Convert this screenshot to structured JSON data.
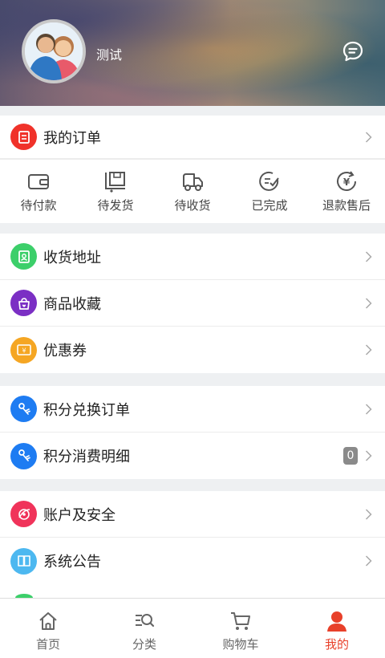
{
  "profile": {
    "username": "测试"
  },
  "orders": {
    "title": "我的订单",
    "statuses": [
      "待付款",
      "待发货",
      "待收货",
      "已完成",
      "退款售后"
    ]
  },
  "menu1": [
    {
      "label": "收货地址",
      "color": "#3ccf6a"
    },
    {
      "label": "商品收藏",
      "color": "#7b2fc4"
    },
    {
      "label": "优惠券",
      "color": "#f5a623"
    }
  ],
  "menu2": [
    {
      "label": "积分兑换订单",
      "color": "#1e7cf2"
    },
    {
      "label": "积分消费明细",
      "color": "#1e7cf2",
      "badge": "0"
    }
  ],
  "menu3": [
    {
      "label": "账户及安全",
      "color": "#f0335a"
    },
    {
      "label": "系统公告",
      "color": "#4db8f0"
    }
  ],
  "tabbar": [
    {
      "label": "首页",
      "icon": "home-icon"
    },
    {
      "label": "分类",
      "icon": "category-search-icon"
    },
    {
      "label": "购物车",
      "icon": "cart-icon"
    },
    {
      "label": "我的",
      "icon": "user-icon",
      "active": true
    }
  ],
  "colors": {
    "accent": "#e8402a",
    "orders_icon": "#f0322a"
  }
}
